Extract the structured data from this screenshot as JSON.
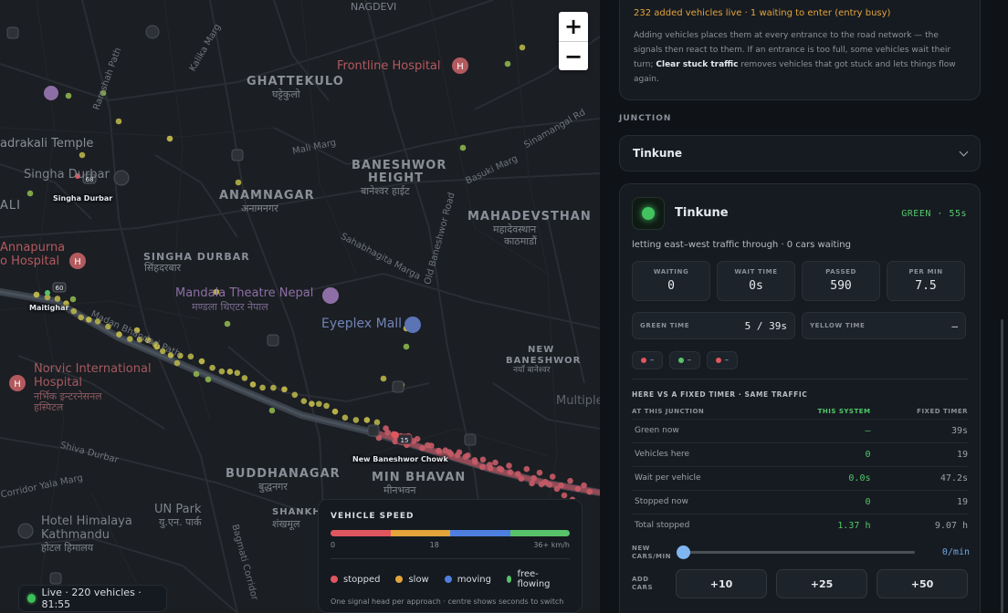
{
  "map": {
    "labels": {
      "nagdevi": "NAGDEVI",
      "frontline": "Frontline Hospital",
      "ghattekulo": "GHATTEKULO",
      "ghattekulo_dev": "घट्टेकुलो",
      "bhadrakali": "adrakali Temple",
      "singha_durbar_poi": "Singha Durbar",
      "singha_durbar_tag": "Singha Durbar",
      "anamnagar": "ANAMNAGAR",
      "anamnagar_dev": "अनामनगर",
      "baneshwor_height": "BANESHWOR",
      "baneshwor_height2": "HEIGHT",
      "baneshwor_height_dev": "बानेश्वर हाईट",
      "mahadevsthan": "MAHADEVSTHAN",
      "mahadevsthan_dev": "महादेवस्थान",
      "mahadevsthan_dev2": "काठमाडौं",
      "singha_durbar": "SINGHA DURBAR",
      "singha_durbar_dev": "सिंहदरबार",
      "annapurna": "Annapurna",
      "annapurna2": "o Hospital",
      "mandala": "Mandala Theatre Nepal",
      "mandala_dev": "मण्डला थिएटर नेपाल",
      "eyeplex": "Eyeplex Mall",
      "maitighar_tag": "Maitighar",
      "norvic": "Norvic International",
      "norvic2": "Hospital",
      "norvic_dev": "नर्भिक इन्टरनेसनल",
      "norvic_dev2": "हस्पिटल",
      "new_baneshwor": "NEW",
      "new_baneshwor2": "BANESHWOR",
      "new_baneshwor_dev": "नयाँ बानेश्वर",
      "new_baneshwor_chowk_tag": "New Baneshwor Chowk",
      "buddhanagar": "BUDDHANAGAR",
      "buddhanagar_dev": "बुद्धनगर",
      "min_bhavan": "MIN BHAVAN",
      "min_bhavan_dev": "मीनभवन",
      "un_park": "UN Park",
      "un_park_dev": "यु.एन. पार्क",
      "himalaya": "Hotel Himalaya",
      "himalaya2": "Kathmandu",
      "himalaya_dev": "होटल हिमालय",
      "shankhamul": "SHANKH",
      "shankhamul_dev": "शंखमूल",
      "multiple": "Multiple",
      "ali": "ALI",
      "ali_mid": "ALI",
      "road_kalika": "Kalika Marg",
      "road_ramshah": "Ramshah Path",
      "road_madan": "Madan Bhandari Path",
      "road_mali": "Mali Marg",
      "road_basuki": "Basuki Marg",
      "road_sinamangal": "Sinamangal Rd",
      "road_sahabhagita": "Sahabhagita Marga",
      "road_old_baneshwor": "Old Baneshwor Road",
      "road_shiva": "Shiva Durbar",
      "road_yala": "Corridor Yala Marg",
      "road_bagmati": "Bagmati Corridor",
      "road_rudra": "Rudra Mati Marg",
      "road_blue": "Shiva Durbar"
    },
    "tags": {
      "a": "68",
      "b": "60",
      "c": "15"
    },
    "zoom_in": "+",
    "zoom_out": "−"
  },
  "live": {
    "text": "Live · 220 vehicles · 81:55"
  },
  "legend": {
    "title": "VEHICLE SPEED",
    "ticks": [
      "0",
      "18",
      "36+ km/h"
    ],
    "colors": [
      "#e0565f",
      "#e3a43a",
      "#4e7fe0",
      "#58c26a"
    ],
    "keys": [
      {
        "label": "stopped",
        "color": "#e0565f"
      },
      {
        "label": "slow",
        "color": "#e3a43a"
      },
      {
        "label": "moving",
        "color": "#4e7fe0"
      },
      {
        "label": "free-flowing",
        "color": "#58c26a"
      }
    ],
    "note": "One signal head per approach · centre shows seconds to switch"
  },
  "panel": {
    "warn": "232 added vehicles live · 1 waiting to enter (entry busy)",
    "desc_a": "Adding vehicles places them at every entrance to the road network — the signals then react to them. If an entrance is too full, some vehicles wait their turn; ",
    "desc_b": "Clear stuck traffic",
    "desc_c": " removes vehicles that got stuck and lets things flow again.",
    "section": "JUNCTION",
    "select_value": "Tinkune",
    "junction": {
      "name": "Tinkune",
      "state": "GREEN · 55s",
      "sub": "letting east–west traffic through · 0 cars waiting",
      "stats": [
        {
          "label": "WAITING",
          "value": "0"
        },
        {
          "label": "WAIT TIME",
          "value": "0s"
        },
        {
          "label": "PASSED",
          "value": "590"
        },
        {
          "label": "PER MIN",
          "value": "7.5"
        }
      ],
      "green_label": "GREEN TIME",
      "green_value": "5 / 39s",
      "yellow_label": "YELLOW TIME",
      "yellow_value": "–",
      "heads": [
        {
          "color": "#e0565f",
          "text": "–"
        },
        {
          "color": "#58c26a",
          "text": "–"
        },
        {
          "color": "#e0565f",
          "text": "–"
        }
      ]
    },
    "compare": {
      "title": "HERE VS A FIXED TIMER · SAME TRAFFIC",
      "cols": [
        "AT THIS JUNCTION",
        "THIS SYSTEM",
        "FIXED TIMER"
      ],
      "rows": [
        [
          "Green now",
          "–",
          "39s"
        ],
        [
          "Vehicles here",
          "0",
          "19"
        ],
        [
          "Wait per vehicle",
          "0.0s",
          "47.2s"
        ],
        [
          "Stopped now",
          "0",
          "19"
        ],
        [
          "Total stopped",
          "1.37 h",
          "9.07 h"
        ]
      ]
    },
    "rate_label": "NEW CARS/MIN",
    "rate_value": "0/min",
    "add_label": "ADD CARS",
    "add_buttons": [
      "+10",
      "+25",
      "+50"
    ]
  }
}
